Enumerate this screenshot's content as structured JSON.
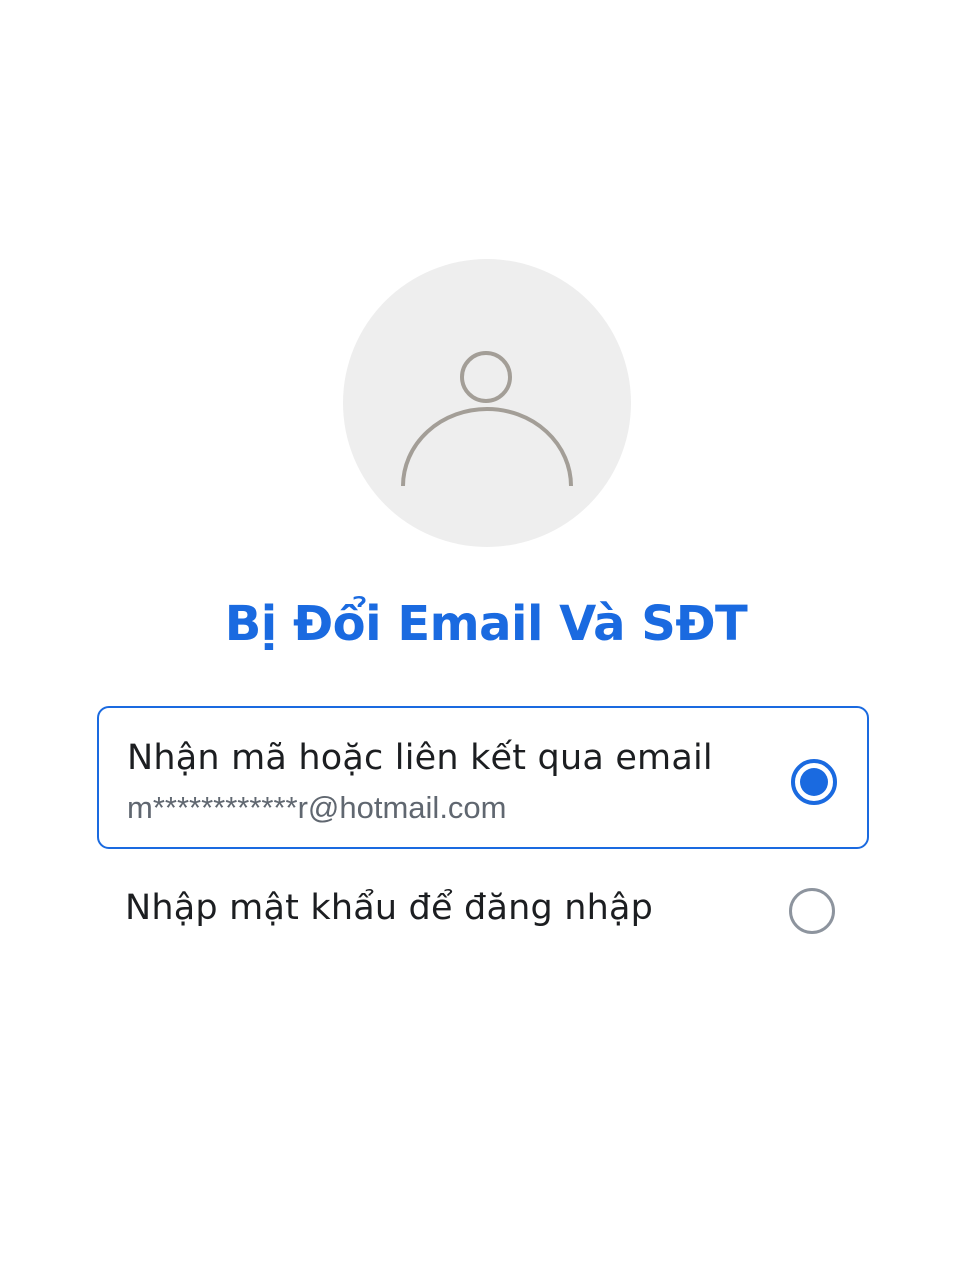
{
  "profile": {
    "avatar_icon": "person-placeholder-icon"
  },
  "title": "Bị Đổi Email Và SĐT",
  "options": [
    {
      "label": "Nhận mã hoặc liên kết qua email",
      "detail": "m************r@hotmail.com",
      "selected": true
    },
    {
      "label": "Nhập mật khẩu để đăng nhập",
      "selected": false
    }
  ],
  "colors": {
    "accent": "#1a6ae0",
    "avatar_bg": "#eeeeee",
    "avatar_stroke": "#a39e97",
    "text": "#1c1e21",
    "subtext": "#606770",
    "radio_off": "#8d949e"
  }
}
